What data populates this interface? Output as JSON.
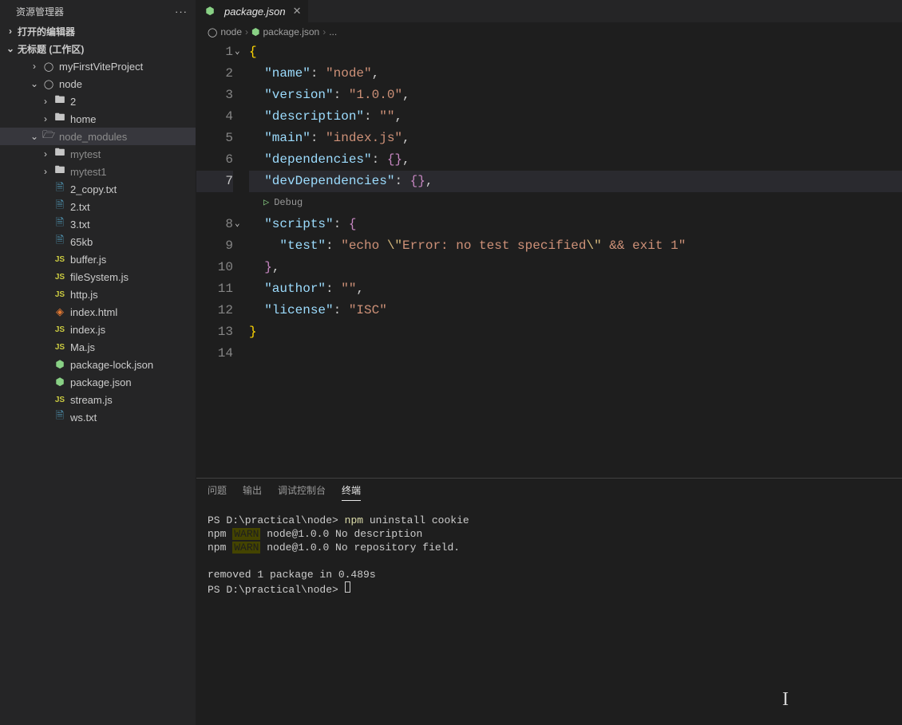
{
  "sidebar": {
    "title": "资源管理器",
    "sections": {
      "openEditors": "打开的编辑器",
      "workspace": "无标题 (工作区)"
    },
    "tree": [
      {
        "label": "myFirstViteProject",
        "icon": "circle",
        "chev": "›",
        "indent": 2,
        "dim": false
      },
      {
        "label": "node",
        "icon": "circle",
        "chev": "⌄",
        "indent": 2,
        "dim": false
      },
      {
        "label": "2",
        "icon": "folder",
        "chev": "›",
        "indent": 3,
        "dim": false
      },
      {
        "label": "home",
        "icon": "folder",
        "chev": "›",
        "indent": 3,
        "dim": false
      },
      {
        "label": "node_modules",
        "icon": "folder-open",
        "chev": "⌄",
        "indent": 2,
        "dim": true,
        "selected": true
      },
      {
        "label": "mytest",
        "icon": "folder",
        "chev": "›",
        "indent": 3,
        "dim": true
      },
      {
        "label": "mytest1",
        "icon": "folder",
        "chev": "›",
        "indent": 3,
        "dim": true
      },
      {
        "label": "2_copy.txt",
        "icon": "txt",
        "chev": "",
        "indent": 3
      },
      {
        "label": "2.txt",
        "icon": "txt",
        "chev": "",
        "indent": 3
      },
      {
        "label": "3.txt",
        "icon": "txt",
        "chev": "",
        "indent": 3
      },
      {
        "label": "65kb",
        "icon": "txt",
        "chev": "",
        "indent": 3
      },
      {
        "label": "buffer.js",
        "icon": "js",
        "chev": "",
        "indent": 3
      },
      {
        "label": "fileSystem.js",
        "icon": "js",
        "chev": "",
        "indent": 3
      },
      {
        "label": "http.js",
        "icon": "js",
        "chev": "",
        "indent": 3
      },
      {
        "label": "index.html",
        "icon": "html",
        "chev": "",
        "indent": 3
      },
      {
        "label": "index.js",
        "icon": "js",
        "chev": "",
        "indent": 3
      },
      {
        "label": "Ma.js",
        "icon": "js",
        "chev": "",
        "indent": 3
      },
      {
        "label": "package-lock.json",
        "icon": "json",
        "chev": "",
        "indent": 3
      },
      {
        "label": "package.json",
        "icon": "json",
        "chev": "",
        "indent": 3
      },
      {
        "label": "stream.js",
        "icon": "js",
        "chev": "",
        "indent": 3
      },
      {
        "label": "ws.txt",
        "icon": "txt",
        "chev": "",
        "indent": 3
      }
    ]
  },
  "tab": {
    "label": "package.json"
  },
  "breadcrumb": {
    "items": [
      "node",
      "package.json",
      "..."
    ]
  },
  "codelens": {
    "debug": "Debug"
  },
  "editor": {
    "lineNumbers": [
      "1",
      "2",
      "3",
      "4",
      "5",
      "6",
      "7",
      "",
      "8",
      "9",
      "10",
      "11",
      "12",
      "13",
      "14"
    ],
    "currentLine": 7,
    "content": {
      "name_key": "\"name\"",
      "name_val": "\"node\"",
      "version_key": "\"version\"",
      "version_val": "\"1.0.0\"",
      "description_key": "\"description\"",
      "description_val": "\"\"",
      "main_key": "\"main\"",
      "main_val": "\"index.js\"",
      "dependencies_key": "\"dependencies\"",
      "devDependencies_key": "\"devDependencies\"",
      "scripts_key": "\"scripts\"",
      "test_key": "\"test\"",
      "test_val_a": "\"echo ",
      "test_esc1": "\\\"",
      "test_val_b": "Error: no test specified",
      "test_esc2": "\\\"",
      "test_val_c": " && exit 1\"",
      "author_key": "\"author\"",
      "author_val": "\"\"",
      "license_key": "\"license\"",
      "license_val": "\"ISC\""
    }
  },
  "panel": {
    "tabs": {
      "problems": "问题",
      "output": "输出",
      "debugConsole": "调试控制台",
      "terminal": "终端"
    }
  },
  "terminal": {
    "prompt1_pre": "PS D:\\practical\\node> ",
    "prompt1_cmd": "npm",
    "prompt1_rest": " uninstall cookie",
    "warn1_pre": "npm ",
    "warn1_tag": "WARN",
    "warn1_msg": " node@1.0.0 No description",
    "warn2_pre": "npm ",
    "warn2_tag": "WARN",
    "warn2_msg": " node@1.0.0 No repository field.",
    "removed": "removed 1 package in 0.489s",
    "prompt2": "PS D:\\practical\\node> "
  }
}
